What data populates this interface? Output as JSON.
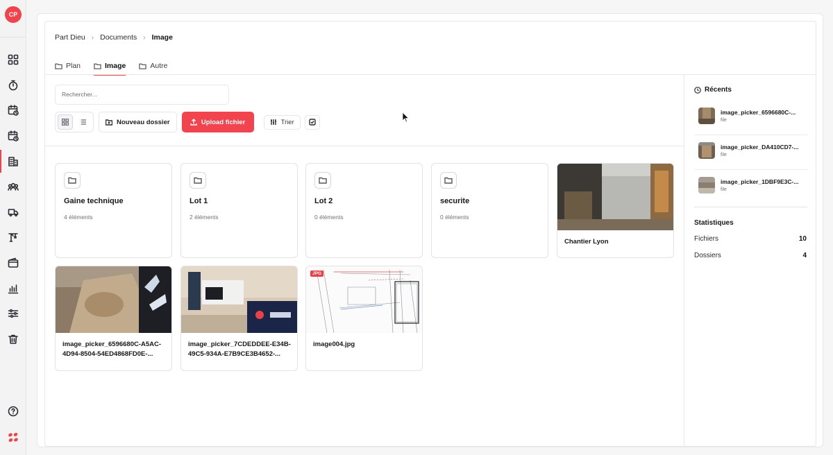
{
  "user": {
    "initials": "CP"
  },
  "sidebar": {
    "icons": [
      "grid-icon",
      "timer-icon",
      "calendar-clock-icon",
      "calendar-clock-icon",
      "building-icon",
      "users-icon",
      "truck-icon",
      "crane-icon",
      "wallet-icon",
      "chart-icon",
      "sliders-icon",
      "trash-icon",
      "help-icon",
      "brand-logo-icon"
    ],
    "active": "building-icon"
  },
  "breadcrumb": {
    "items": [
      "Part Dieu",
      "Documents"
    ],
    "current": "Image"
  },
  "tabs": [
    {
      "label": "Plan",
      "active": false
    },
    {
      "label": "Image",
      "active": true
    },
    {
      "label": "Autre",
      "active": false
    }
  ],
  "search": {
    "placeholder": "Rechercher..."
  },
  "toolbar": {
    "new_folder": "Nouveau dossier",
    "upload": "Upload fichier",
    "sort": "Trier",
    "view_mode": "grid"
  },
  "folders": [
    {
      "name": "Gaine technique",
      "count": "4 éléments"
    },
    {
      "name": "Lot 1",
      "count": "2 éléments"
    },
    {
      "name": "Lot 2",
      "count": "0 éléments"
    },
    {
      "name": "securite",
      "count": "0 éléments"
    }
  ],
  "files": [
    {
      "name": "Chantier Lyon"
    },
    {
      "name": "image_picker_6596680C-A5AC-4D94-8504-54ED4868FD0E-..."
    },
    {
      "name": "image_picker_7CDEDDEE-E34B-49C5-934A-E7B9CE3B4652-..."
    },
    {
      "name": "image004.jpg",
      "badge": "JPG"
    }
  ],
  "recents": {
    "title": "Récents",
    "items": [
      {
        "name": "image_picker_6596680C-...",
        "type": "file"
      },
      {
        "name": "image_picker_DA410CD7-...",
        "type": "file"
      },
      {
        "name": "image_picker_1DBF9E3C-...",
        "type": "file"
      }
    ]
  },
  "stats": {
    "title": "Statistiques",
    "files_label": "Fichiers",
    "files_value": "10",
    "folders_label": "Dossiers",
    "folders_value": "4"
  },
  "colors": {
    "accent": "#f2444e",
    "border": "#e7e7ea"
  }
}
